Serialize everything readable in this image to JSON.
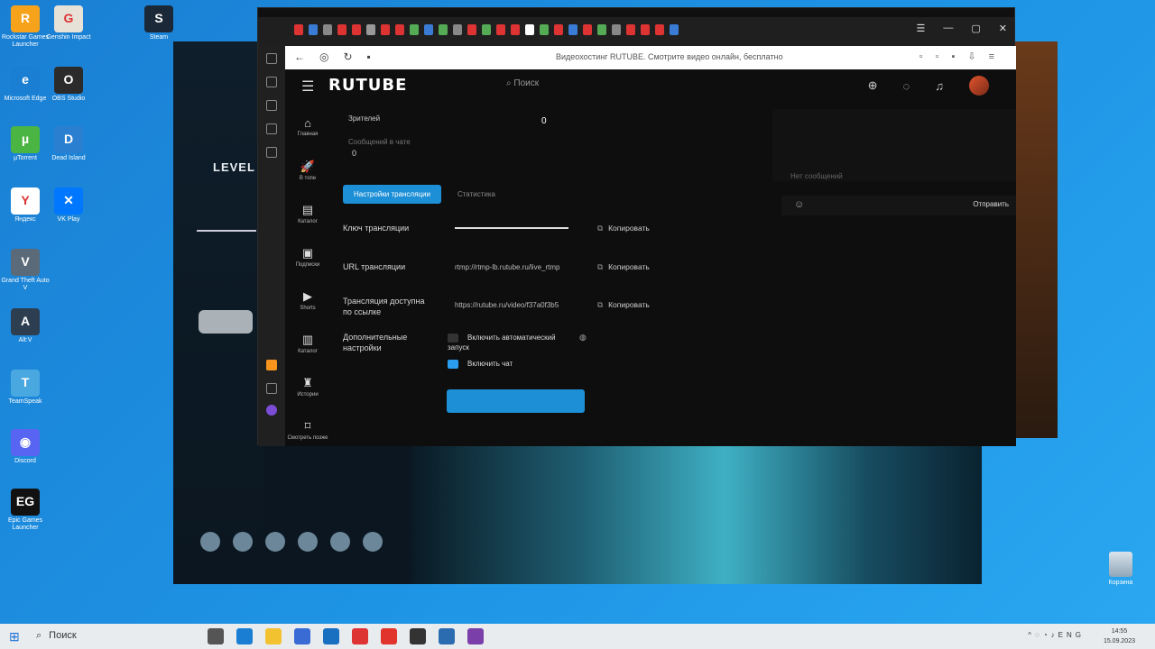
{
  "desktop": {
    "icons": [
      {
        "label": "Rockstar Games Launcher",
        "glyph": "R",
        "color": "#f6a21a"
      },
      {
        "label": "Genshin Impact",
        "glyph": "G",
        "color": "#e7e2d8"
      },
      {
        "label": "Steam",
        "glyph": "S",
        "color": "#1b2838"
      },
      {
        "label": "Microsoft Edge",
        "glyph": "e",
        "color": "#1a7fd3"
      },
      {
        "label": "OBS Studio",
        "glyph": "O",
        "color": "#2b2b2b"
      },
      {
        "label": "µTorrent",
        "glyph": "µ",
        "color": "#4bb543"
      },
      {
        "label": "Dead Island",
        "glyph": "D",
        "color": "#2a7fd0"
      },
      {
        "label": "Яндекс",
        "glyph": "Y",
        "color": "#ffffff"
      },
      {
        "label": "VK Play",
        "glyph": "✕",
        "color": "#0077ff"
      },
      {
        "label": "Grand Theft Auto V",
        "glyph": "V",
        "color": "#5a6a78"
      },
      {
        "label": "Alt:V",
        "glyph": "A",
        "color": "#2c3e50"
      },
      {
        "label": "TeamSpeak",
        "glyph": "T",
        "color": "#4aa8e0"
      },
      {
        "label": "Discord",
        "glyph": "◉",
        "color": "#5865f2"
      },
      {
        "label": "Epic Games Launcher",
        "glyph": "EG",
        "color": "#111111"
      }
    ],
    "recycle_bin": "Корзина"
  },
  "launcher": {
    "level": "LEVEL"
  },
  "browser": {
    "tab_title": "Видеохостинг RUTUBE. Смотрите видео онлайн, бесплатно"
  },
  "rutube": {
    "logo": "RUTUBE",
    "search_placeholder": "Поиск",
    "nav": [
      {
        "label": "Главная",
        "icon": "⌂"
      },
      {
        "label": "В топе",
        "icon": "🚀"
      },
      {
        "label": "Каталог",
        "icon": "▤"
      },
      {
        "label": "Подписки",
        "icon": "▣"
      },
      {
        "label": "Shorts",
        "icon": "▶"
      },
      {
        "label": "Каталог",
        "icon": "▥"
      },
      {
        "label": "Истории",
        "icon": "♜"
      },
      {
        "label": "Смотреть позже",
        "icon": "⌑"
      }
    ],
    "stats": {
      "viewers_label": "Зрителей",
      "viewers_value": "0",
      "messages_label": "Сообщений в чате",
      "messages_value": "0"
    },
    "tabs": {
      "active": "Настройки трансляции",
      "other": "Статистика"
    },
    "fields": {
      "key_label": "Ключ трансляции",
      "url_label": "URL трансляции",
      "url_value": "rtmp://rtmp-lb.rutube.ru/live_rtmp",
      "link_label": "Трансляция доступна по ссылке",
      "link_value": "https://rutube.ru/video/f37a0f3b5",
      "copy_label": "Копировать",
      "extra_label": "Дополнительные настройки",
      "autostart_label": "Включить автоматический запуск",
      "chat_label": "Включить чат"
    },
    "chat": {
      "empty_text": "Нет сообщений",
      "send_label": "Отправить"
    }
  },
  "taskbar": {
    "search_label": "Поиск",
    "lang": "ENG",
    "time": "14:55",
    "date": "15.09.2023"
  }
}
